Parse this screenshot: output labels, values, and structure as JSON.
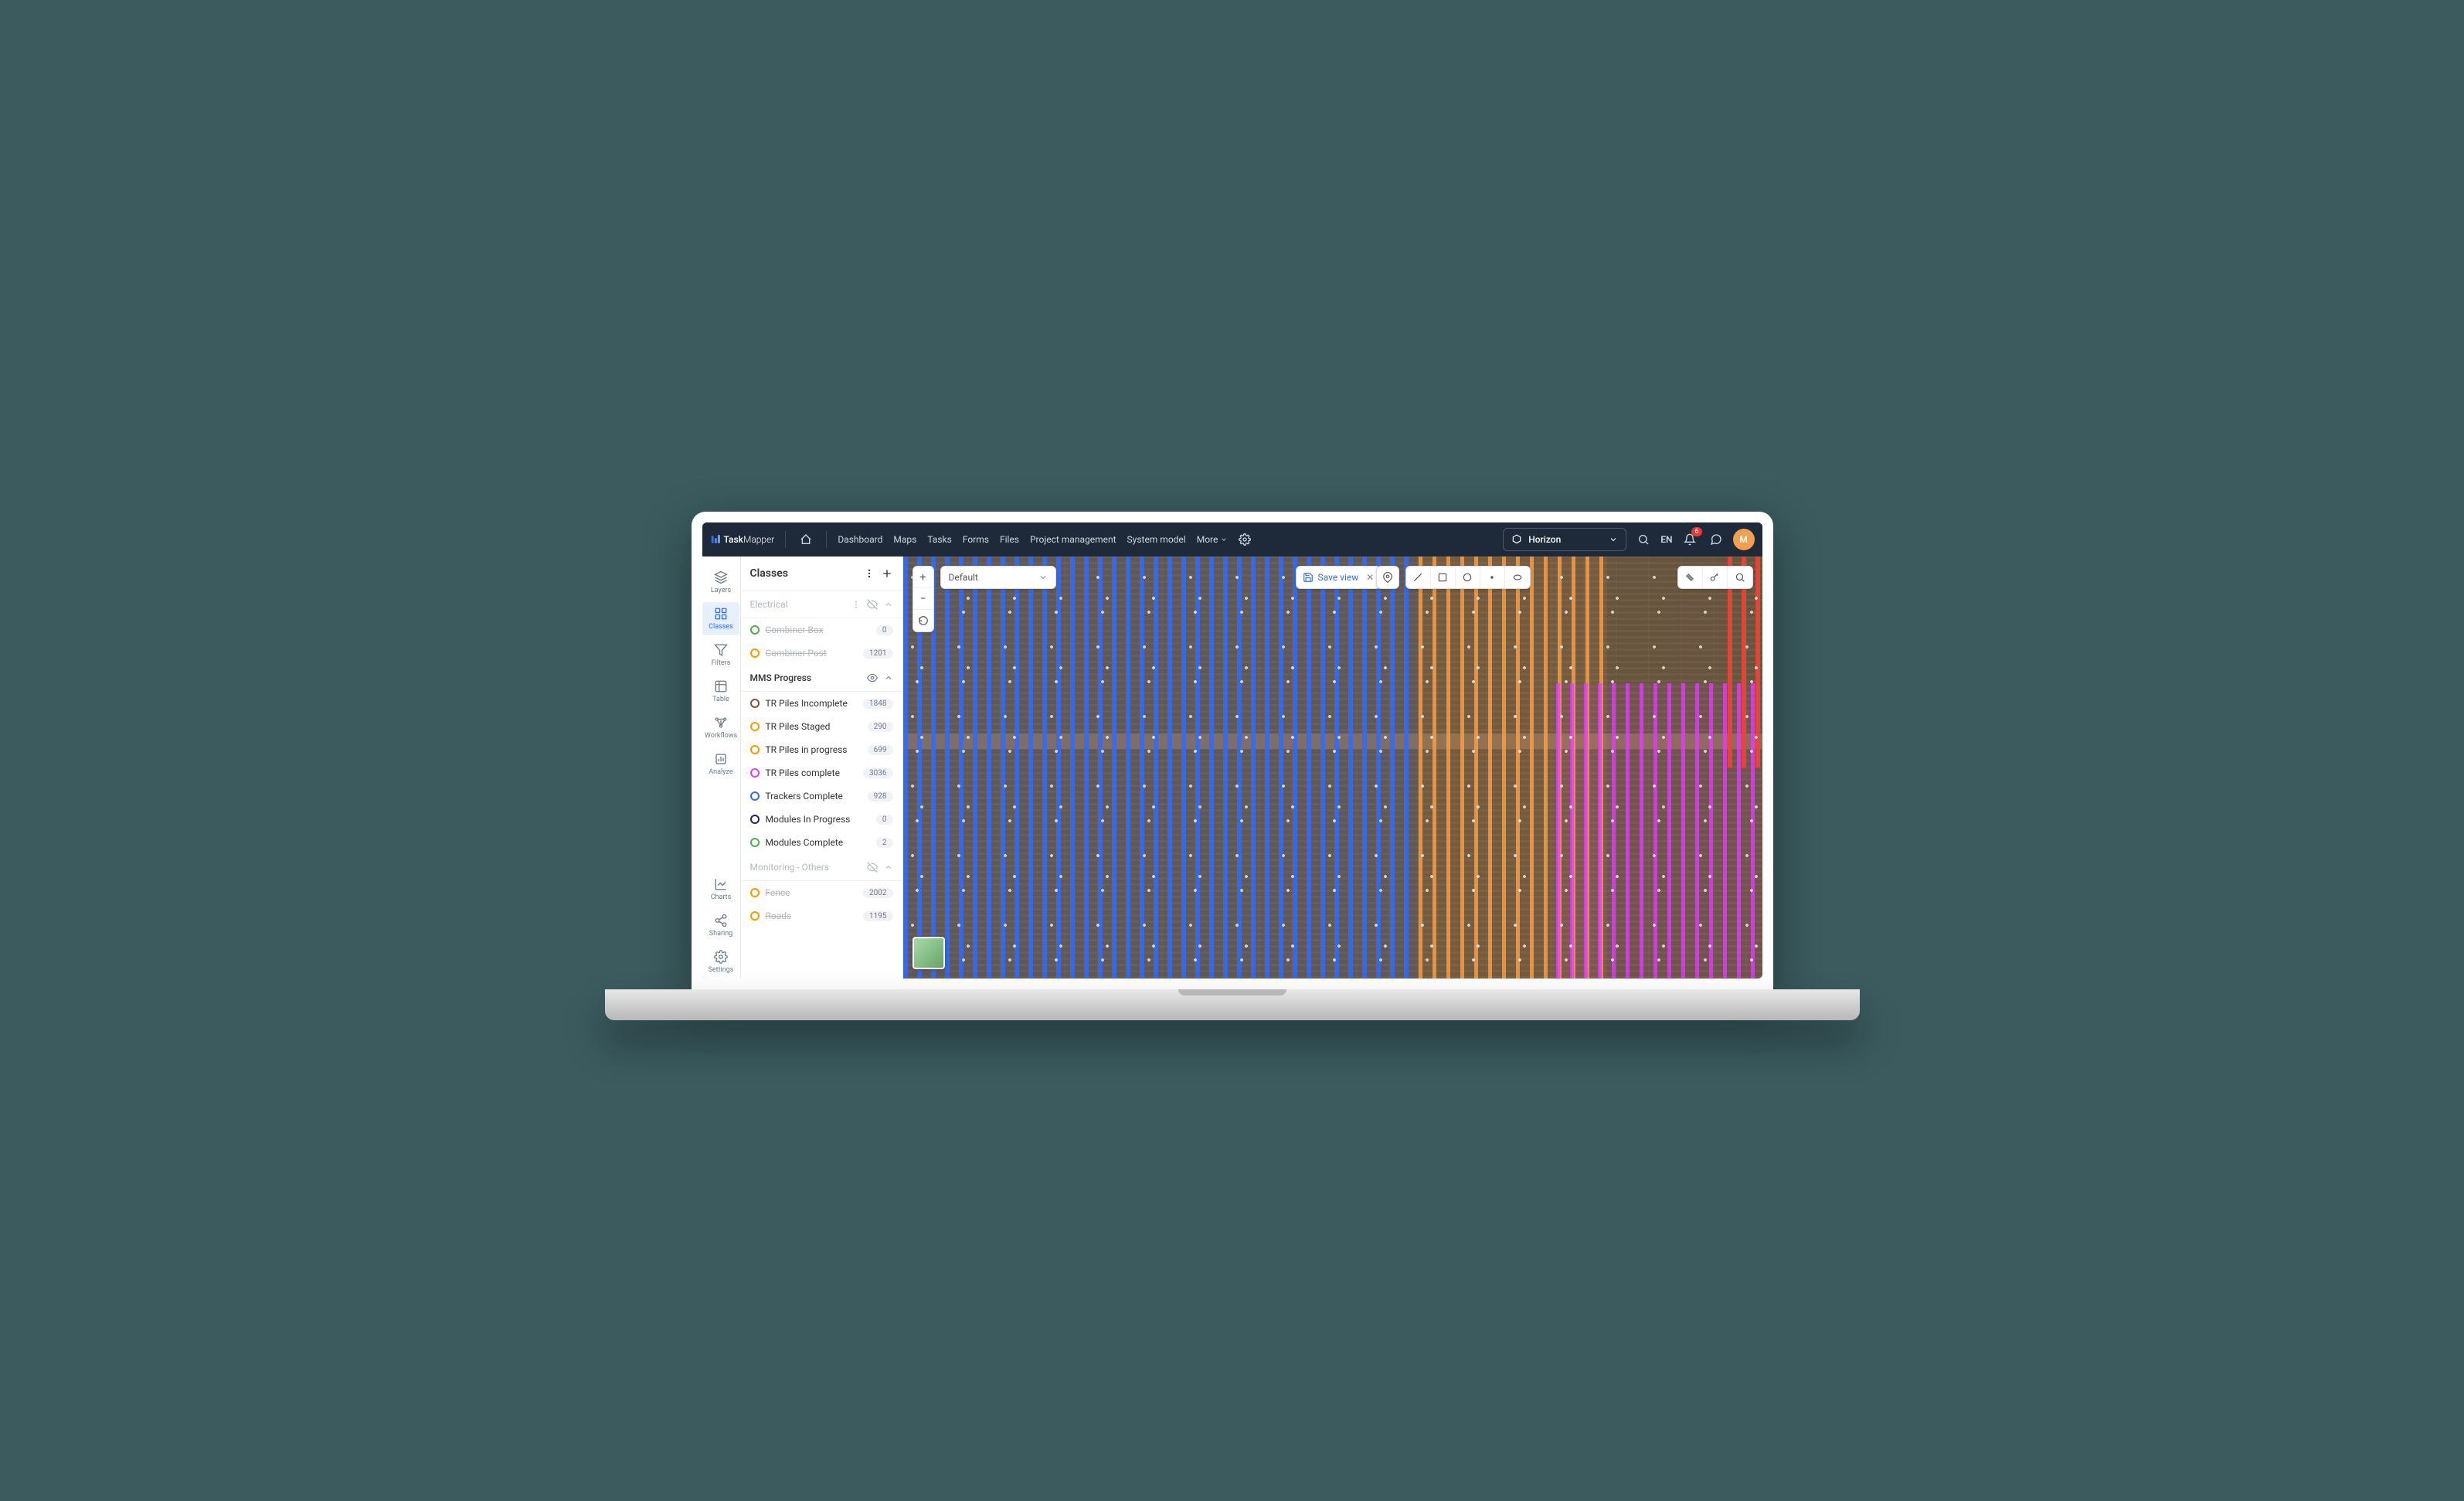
{
  "app_name_prefix": "Task",
  "app_name_suffix": "Mapper",
  "nav": {
    "dashboard": "Dashboard",
    "maps": "Maps",
    "tasks": "Tasks",
    "forms": "Forms",
    "files": "Files",
    "project_mgmt": "Project management",
    "system_model": "System model",
    "more": "More"
  },
  "workspace": "Horizon",
  "lang": "EN",
  "notif_count": "6",
  "avatar_initial": "M",
  "rail": {
    "layers": "Layers",
    "classes": "Classes",
    "filters": "Filters",
    "table": "Table",
    "workflows": "Workflows",
    "analyze": "Analyze",
    "charts": "Charts",
    "sharing": "Sharing",
    "settings": "Settings"
  },
  "panel_title": "Classes",
  "groups": {
    "electrical": {
      "title": "Electrical"
    },
    "mms": {
      "title": "MMS Progress"
    },
    "monitoring": {
      "title": "Monitoring - Others"
    }
  },
  "classes": {
    "combiner_box": {
      "name": "Combiner Box",
      "count": "0",
      "color": "#4caf50"
    },
    "combiner_post": {
      "name": "Combiner Post",
      "count": "1201",
      "color": "#ff9800"
    },
    "piles_incomplete": {
      "name": "TR Piles Incomplete",
      "count": "1848",
      "color": "#795548"
    },
    "piles_staged": {
      "name": "TR Piles Staged",
      "count": "290",
      "color": "#ff9800"
    },
    "piles_progress": {
      "name": "TR Piles in progress",
      "count": "699",
      "color": "#ff9800"
    },
    "piles_complete": {
      "name": "TR Piles complete",
      "count": "3036",
      "color": "#e040fb"
    },
    "trackers_complete": {
      "name": "Trackers Complete",
      "count": "928",
      "color": "#2f6bff"
    },
    "modules_progress": {
      "name": "Modules In Progress",
      "count": "0",
      "color": "#1a237e"
    },
    "modules_complete": {
      "name": "Modules Complete",
      "count": "2",
      "color": "#4caf50"
    },
    "fence": {
      "name": "Fence",
      "count": "2002",
      "color": "#ff9800"
    },
    "roads": {
      "name": "Roads",
      "count": "1195",
      "color": "#ff9800"
    }
  },
  "view_select": "Default",
  "save_view_label": "Save view"
}
